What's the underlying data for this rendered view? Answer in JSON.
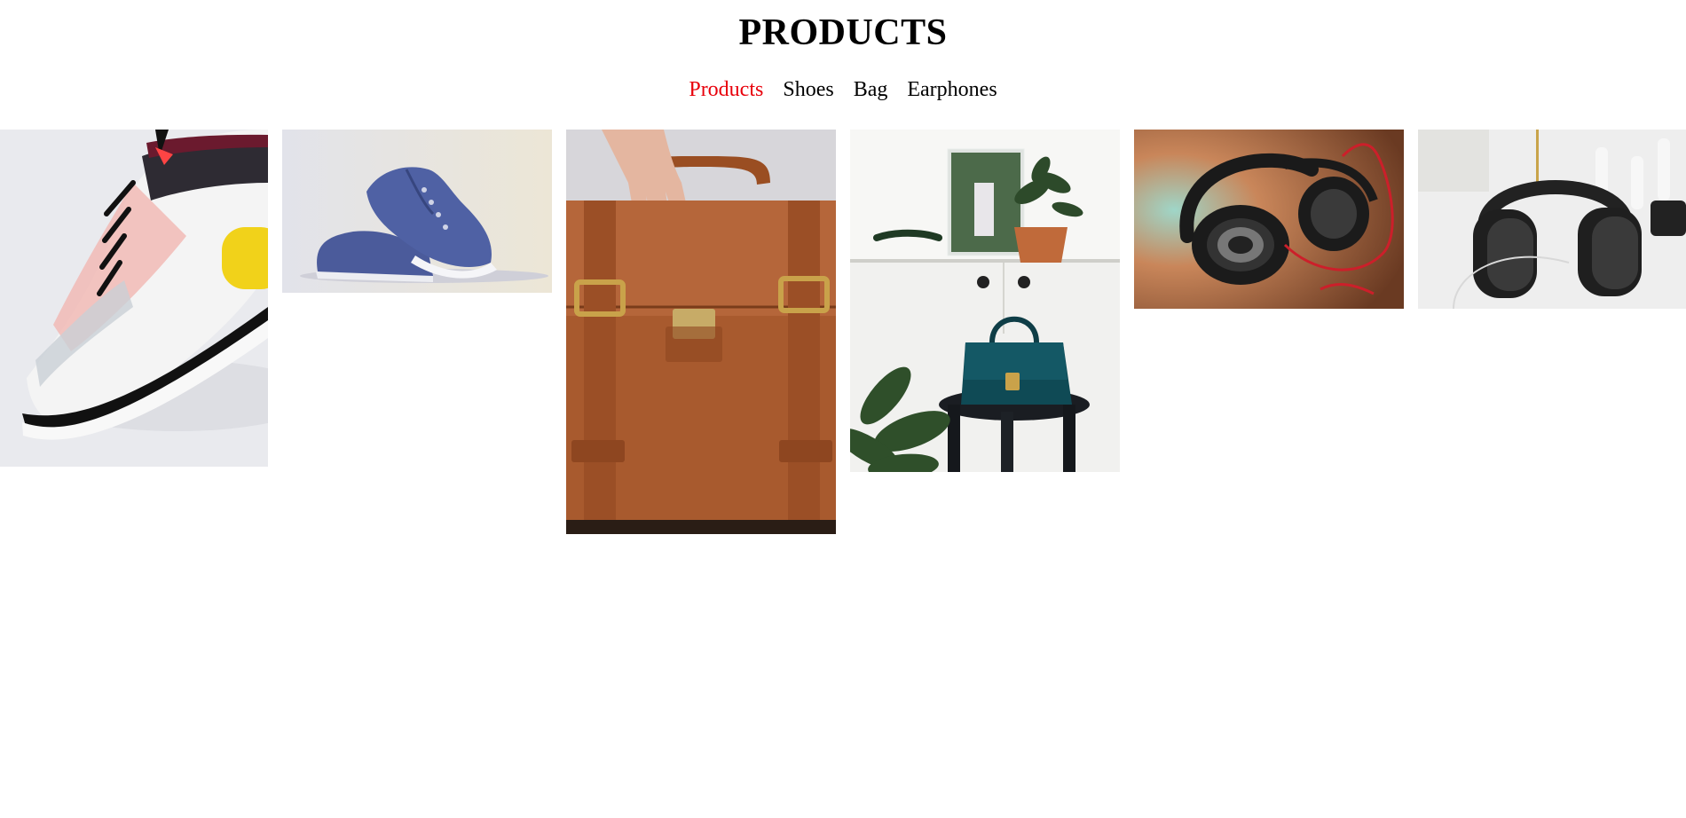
{
  "page": {
    "title": "PRODUCTS"
  },
  "nav": {
    "items": [
      {
        "label": "Products",
        "active": true
      },
      {
        "label": "Shoes",
        "active": false
      },
      {
        "label": "Bag",
        "active": false
      },
      {
        "label": "Earphones",
        "active": false
      }
    ],
    "active_color": "#e8000b"
  },
  "gallery": {
    "items": [
      {
        "name": "sneaker-white-yellow",
        "category": "Shoes"
      },
      {
        "name": "canvas-shoes-blue",
        "category": "Shoes"
      },
      {
        "name": "leather-satchel-brown",
        "category": "Bag"
      },
      {
        "name": "handbag-teal",
        "category": "Bag"
      },
      {
        "name": "headphones-red-cable",
        "category": "Earphones"
      },
      {
        "name": "headphones-black",
        "category": "Earphones"
      }
    ]
  }
}
